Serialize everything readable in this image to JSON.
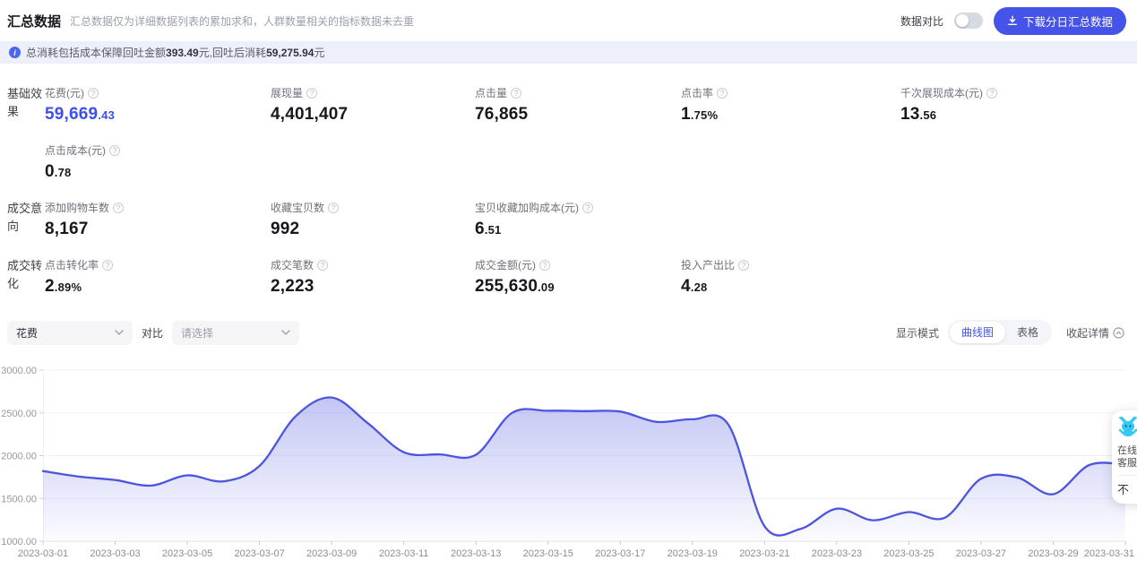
{
  "header": {
    "title": "汇总数据",
    "subtitle": "汇总数据仅为详细数据列表的累加求和，人群数量相关的指标数据未去重",
    "compare_label": "数据对比",
    "compare_toggle_state": "off",
    "download_label": "下载分日汇总数据"
  },
  "banner": {
    "prefix": "总消耗包括成本保障回吐金额",
    "bold1": "393.49",
    "mid": "元,回吐后消耗",
    "bold2": "59,275.94",
    "suffix": "元"
  },
  "metric_sections": [
    {
      "label": "基础效果",
      "rows": [
        [
          {
            "label": "花费(元)",
            "main": "59,669",
            "sub": ".43",
            "accent": true
          },
          {
            "label": "展现量",
            "main": "4,401,407",
            "sub": ""
          },
          {
            "label": "点击量",
            "main": "76,865",
            "sub": ""
          },
          {
            "label": "点击率",
            "main": "1",
            "sub": ".75%"
          },
          {
            "label": "千次展现成本(元)",
            "main": "13",
            "sub": ".56"
          }
        ],
        [
          {
            "label": "点击成本(元)",
            "main": "0",
            "sub": ".78"
          }
        ]
      ]
    },
    {
      "label": "成交意向",
      "rows": [
        [
          {
            "label": "添加购物车数",
            "main": "8,167",
            "sub": ""
          },
          {
            "label": "收藏宝贝数",
            "main": "992",
            "sub": ""
          },
          {
            "label": "宝贝收藏加购成本(元)",
            "main": "6",
            "sub": ".51"
          }
        ]
      ]
    },
    {
      "label": "成交转化",
      "rows": [
        [
          {
            "label": "点击转化率",
            "main": "2",
            "sub": ".89%"
          },
          {
            "label": "成交笔数",
            "main": "2,223",
            "sub": ""
          },
          {
            "label": "成交金额(元)",
            "main": "255,630",
            "sub": ".09"
          },
          {
            "label": "投入产出比",
            "main": "4",
            "sub": ".28"
          }
        ]
      ]
    }
  ],
  "filters": {
    "metric_select_value": "花费",
    "compare_label": "对比",
    "compare_placeholder": "请选择",
    "display_mode_label": "显示模式",
    "modes": [
      "曲线图",
      "表格"
    ],
    "selected_mode": "曲线图",
    "collapse_label": "收起详情"
  },
  "chart_data": {
    "type": "area",
    "title": "",
    "xlabel": "",
    "ylabel": "",
    "x": [
      "2023-03-01",
      "2023-03-02",
      "2023-03-03",
      "2023-03-04",
      "2023-03-05",
      "2023-03-06",
      "2023-03-07",
      "2023-03-08",
      "2023-03-09",
      "2023-03-10",
      "2023-03-11",
      "2023-03-12",
      "2023-03-13",
      "2023-03-14",
      "2023-03-15",
      "2023-03-16",
      "2023-03-17",
      "2023-03-18",
      "2023-03-19",
      "2023-03-20",
      "2023-03-21",
      "2023-03-22",
      "2023-03-23",
      "2023-03-24",
      "2023-03-25",
      "2023-03-26",
      "2023-03-27",
      "2023-03-28",
      "2023-03-29",
      "2023-03-30",
      "2023-03-31"
    ],
    "series": [
      {
        "name": "花费",
        "values": [
          1820,
          1755,
          1715,
          1650,
          1770,
          1700,
          1880,
          2460,
          2680,
          2380,
          2040,
          2015,
          2010,
          2500,
          2525,
          2520,
          2515,
          2395,
          2425,
          2360,
          1175,
          1145,
          1380,
          1245,
          1340,
          1275,
          1730,
          1745,
          1550,
          1890,
          1895
        ]
      }
    ],
    "ylim": [
      1000,
      3000
    ],
    "ytick_labels": [
      "1000.00",
      "1500.00",
      "2000.00",
      "2500.00",
      "3000.00"
    ],
    "xtick_every": 2,
    "grid": "horizontal",
    "legend": "none",
    "line_color": "#4c55dd",
    "fill_color": "#545ce2"
  },
  "widget": {
    "line1": "在线",
    "line2": "客服",
    "more": "不"
  },
  "colors": {
    "accent_value": "#3b50ef",
    "button": "#4553e8",
    "banner_bg": "#edeffa",
    "toggle_off": "#d7d9e3"
  }
}
